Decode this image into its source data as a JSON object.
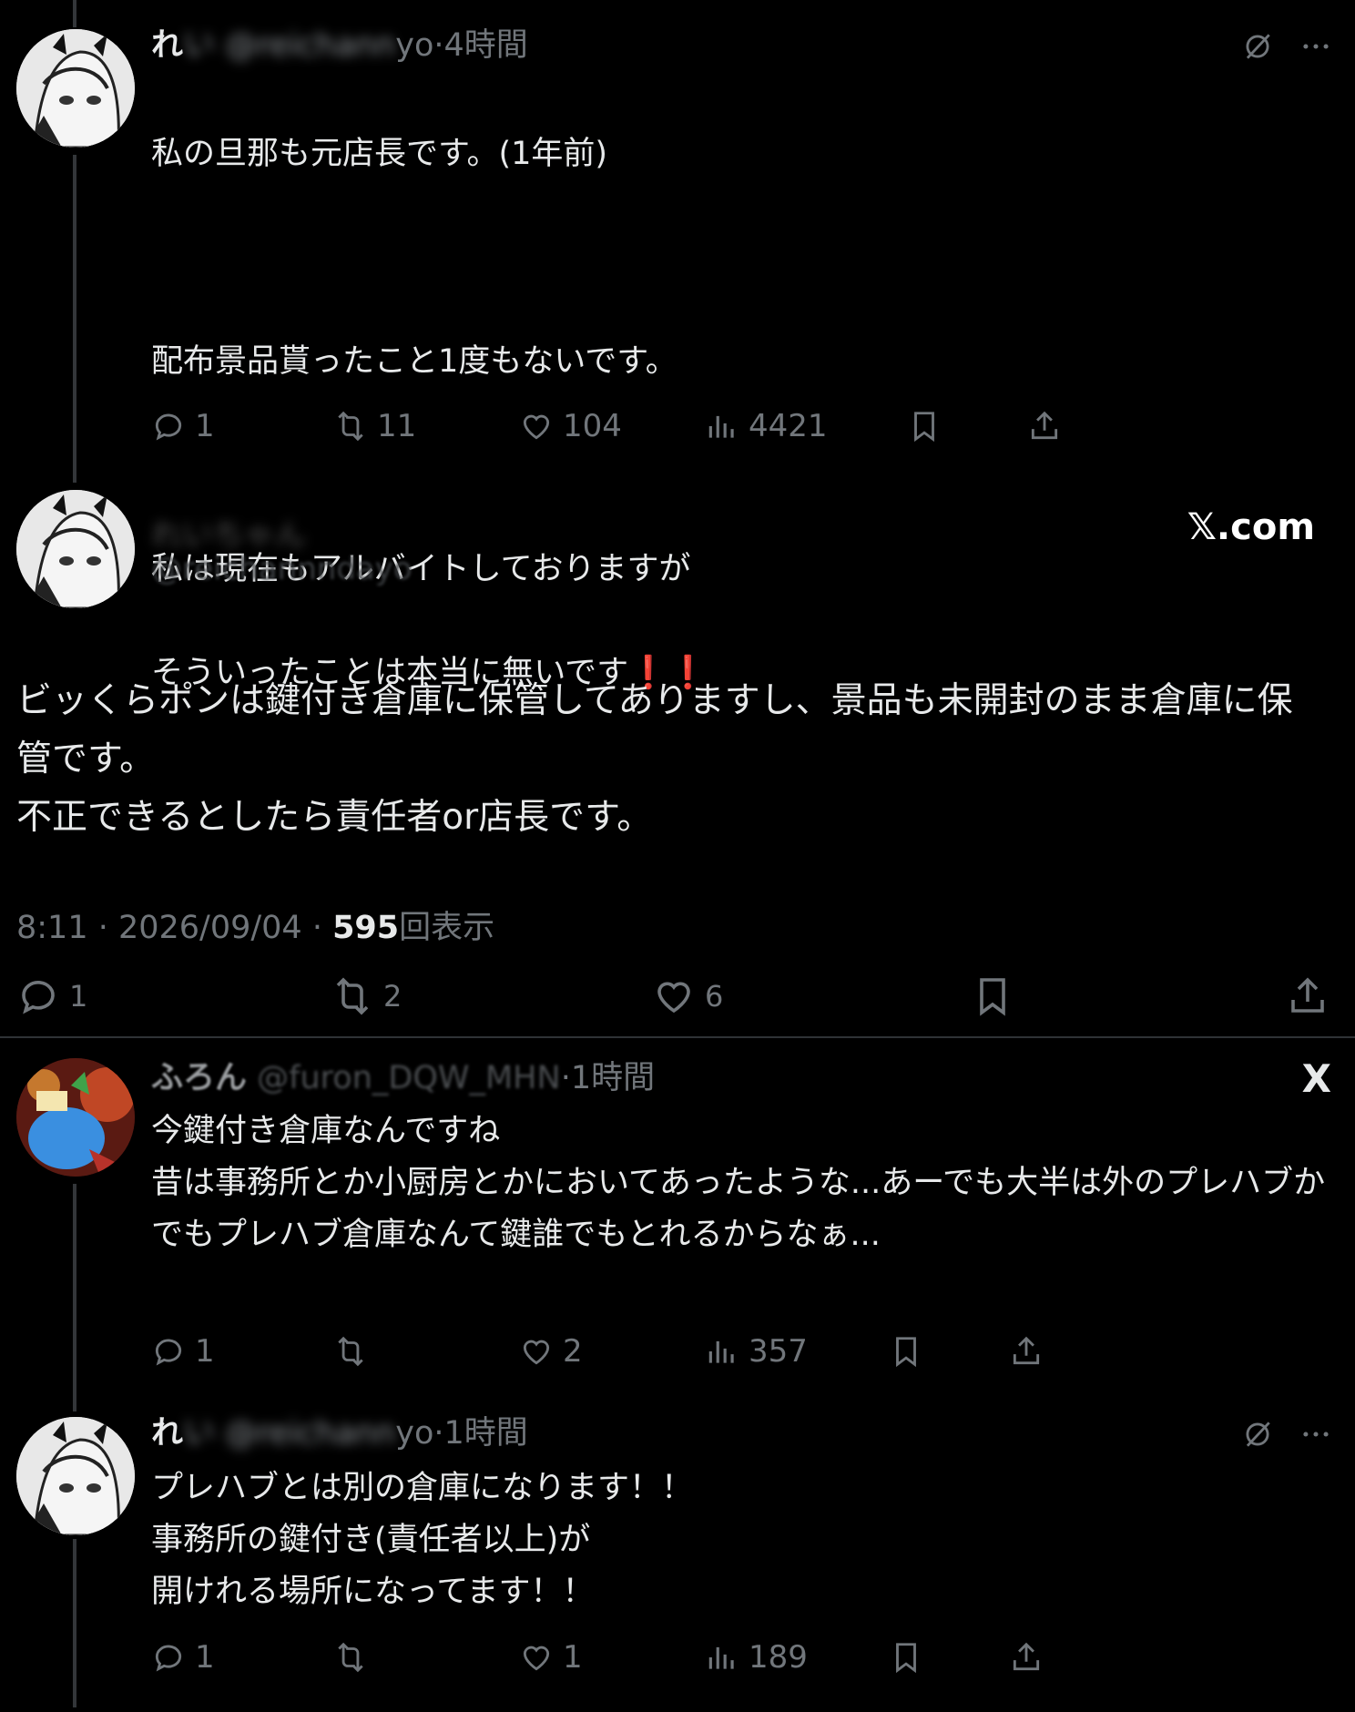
{
  "tweet1": {
    "name": "れ",
    "handle_visible": "yo",
    "time": "·4時間",
    "lines": [
      "私の旦那も元店長です。(1年前)",
      "",
      "配布景品貰ったこと1度もないです。",
      "",
      "私は現在もアルバイトしておりますが",
      "そういったことは本当に無いです❗️❗️"
    ],
    "stats": {
      "reply": "1",
      "retweet": "11",
      "like": "104",
      "views": "4421"
    }
  },
  "main_tweet": {
    "handle": "@reichannndayo",
    "source_label": "𝕏.com",
    "text": "ビッくらポンは鍵付き倉庫に保管してありますし、景品も未開封のまま倉庫に保管です。\n不正できるとしたら責任者or店長です。",
    "timestamp": "8:11 · 2026/09/04 · ",
    "views_count": "595",
    "views_label": "回表示",
    "stats": {
      "reply": "1",
      "retweet": "2",
      "like": "6"
    }
  },
  "tweet3": {
    "name": "ふろん",
    "handle": "@furon_DQW_MHN",
    "time": "·1時間",
    "x_logo": "X",
    "text": "今鍵付き倉庫なんですね\n昔は事務所とか小厨房とかにおいてあったような...あーでも大半は外のプレハブか\nでもプレハブ倉庫なんて鍵誰でもとれるからなぁ...",
    "stats": {
      "reply": "1",
      "retweet": "",
      "like": "2",
      "views": "357"
    }
  },
  "tweet4": {
    "name": "れ",
    "handle_visible": "yo",
    "time": "·1時間",
    "text": "プレハブとは別の倉庫になります！！\n事務所の鍵付き(責任者以上)が\n開けれる場所になってます！！",
    "stats": {
      "reply": "1",
      "retweet": "",
      "like": "1",
      "views": "189"
    }
  },
  "icons": [
    "reply-icon",
    "retweet-icon",
    "like-icon",
    "views-icon",
    "bookmark-icon",
    "share-icon",
    "grok-icon",
    "more-icon",
    "x-logo-icon"
  ],
  "colors": {
    "background": "#000000",
    "text": "#e7e9ea",
    "muted": "#71767b",
    "divider": "#2f3336",
    "exclaim": "#e0161e"
  }
}
